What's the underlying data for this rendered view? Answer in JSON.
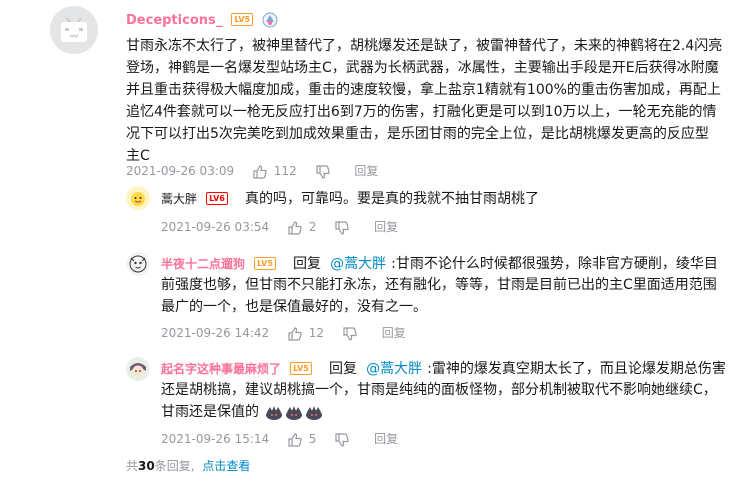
{
  "main_comment": {
    "username": "Decepticons_",
    "username_color": "#fb7299",
    "level": "LV5",
    "level_color": "#ff9c2b",
    "lines": [
      "甘雨永冻不太行了，被神里替代了，胡桃爆发还是缺了，被雷神替代了，未来的神鹤将在2.4闪亮",
      "登场，神鹤是一名爆发型站场主C，武器为长柄武器，冰属性，主要输出手段是开E后获得冰附魔",
      "并且重击获得极大幅度加成，重击的速度较慢，拿上盐京1精就有100%的重击伤害加成，再配上",
      "追忆4件套就可以一枪无反应打出6到7万的伤害，打融化更是可以到10万以上，一轮无充能的情",
      "况下可以打出5次完美吃到加成效果重击，是乐团甘雨的完全上位，是比胡桃爆发更高的反应型",
      "主C"
    ],
    "time": "2021-09-26 03:09",
    "likes": "112",
    "reply_label": "回复"
  },
  "replies": [
    {
      "username": "蒿大胖",
      "username_color": "#18191c",
      "level": "LV6",
      "level_color": "#ff0000",
      "lines": [
        "真的吗，可靠吗。要是真的我就不抽甘雨胡桃了"
      ],
      "time": "2021-09-26 03:54",
      "likes": "2",
      "reply_label": "回复"
    },
    {
      "username": "半夜十二点遛狗",
      "username_color": "#fb7299",
      "level": "LV5",
      "level_color": "#ff9c2b",
      "reply_prefix": "回复",
      "mention": "@蒿大胖",
      "line1_text": ":甘雨不论什么时候都很强势，除非官方硬削，绫华目",
      "lines": [
        "前强度也够，但甘雨不只能打永冻，还有融化，等等，甘雨是目前已出的主C里面适用范围",
        "最广的一个，也是保值最好的，没有之一。"
      ],
      "time": "2021-09-26 14:42",
      "likes": "12",
      "reply_label": "回复"
    },
    {
      "username": "起名字这种事最麻烦了",
      "username_color": "#fb7299",
      "level": "LV5",
      "level_color": "#ff9c2b",
      "reply_prefix": "回复",
      "mention": "@蒿大胖",
      "line1_text": ":雷神的爆发真空期太长了，而且论爆发期总伤害",
      "lines": [
        "还是胡桃搞，建议胡桃搞一个，甘雨是纯纯的面板怪物，部分机制被取代不影响她继续C，",
        "甘雨还是保值的"
      ],
      "time": "2021-09-26 15:14",
      "likes": "5",
      "reply_label": "回复"
    }
  ],
  "footer": {
    "total_prefix": "共",
    "total_count": "30",
    "total_suffix": "条回复,",
    "view_link": "点击查看"
  }
}
